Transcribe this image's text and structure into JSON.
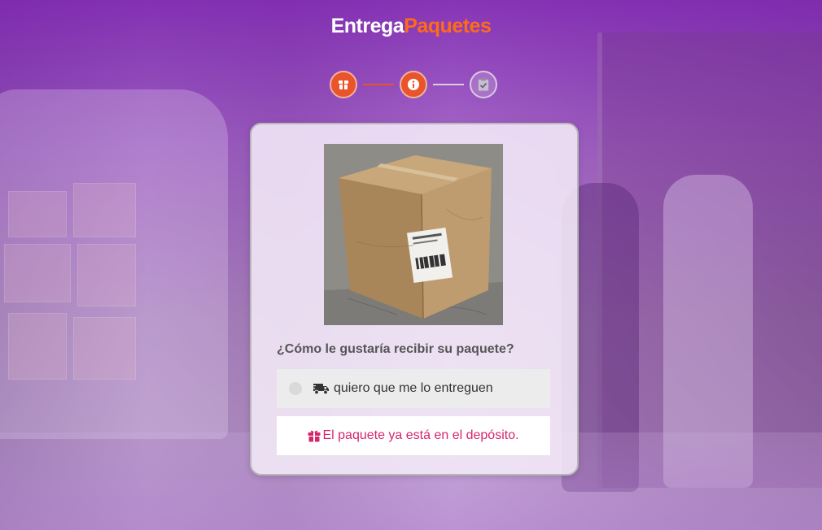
{
  "logo": {
    "part1": "Entrega",
    "part2": "Paquetes"
  },
  "stepper": {
    "steps": [
      {
        "icon": "box-icon",
        "state": "active"
      },
      {
        "icon": "info-icon",
        "state": "active"
      },
      {
        "icon": "clipboard-check-icon",
        "state": "inactive"
      }
    ]
  },
  "card": {
    "image": "package-photo",
    "question": "¿Cómo le gustaría recibir su paquete?",
    "options": [
      {
        "label": "quiero que me lo entreguen",
        "icon": "truck-icon"
      },
      {
        "label": "El paquete ya está en el depósito.",
        "icon": "gift-icon"
      }
    ]
  },
  "colors": {
    "accent": "#e9542b",
    "logo_orange": "#ff6a1a",
    "depot_text": "#d6266b",
    "background_purple": "#9a4fc7"
  }
}
